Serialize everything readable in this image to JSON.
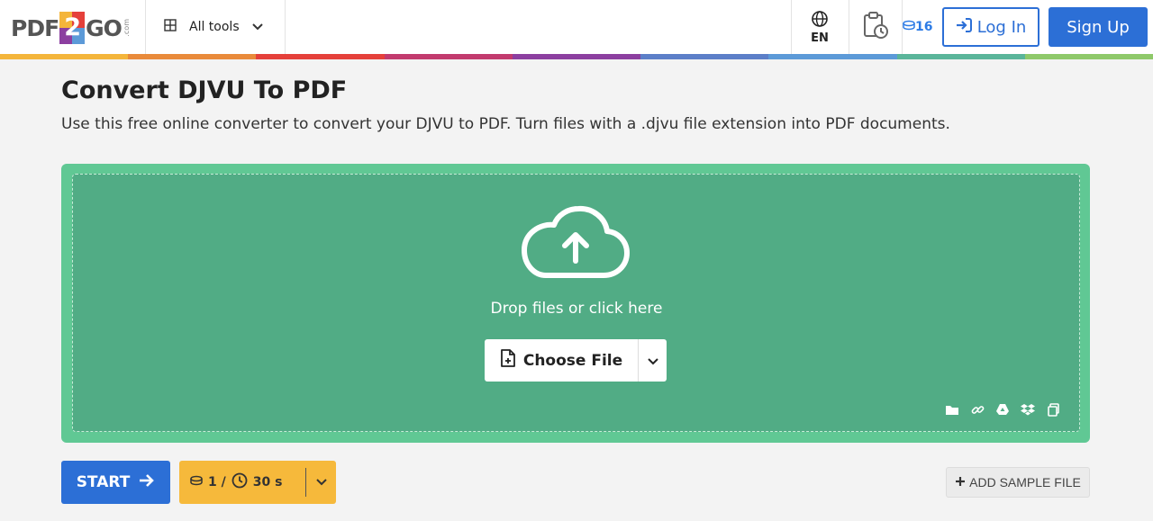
{
  "header": {
    "logo": {
      "left": "PDF",
      "middle": "2",
      "right": "GO",
      "suffix": ".com"
    },
    "all_tools_label": "All tools",
    "language_label": "EN",
    "credits": "16",
    "login_label": "Log In",
    "signup_label": "Sign Up",
    "rainbow_colors": [
      "#f4b53b",
      "#e98a3a",
      "#e5403a",
      "#c23a6e",
      "#8c3fa0",
      "#5c7fc8",
      "#5c9ad8",
      "#5ab59a",
      "#8fc96a"
    ]
  },
  "main": {
    "title": "Convert DJVU To PDF",
    "description": "Use this free online converter to convert your DJVU to PDF. Turn files with a .djvu file extension into PDF documents.",
    "drop_text": "Drop files or click here",
    "choose_file_label": "Choose File",
    "source_icons": [
      "folder-icon",
      "link-icon",
      "google-drive-icon",
      "dropbox-icon",
      "clipboard-icon"
    ]
  },
  "actions": {
    "start_label": "START",
    "cost_credits": "1 /",
    "cost_time": "30 s",
    "add_sample_label": "ADD SAMPLE FILE"
  },
  "colors": {
    "accent_blue": "#2c6fd6",
    "drop_outer": "#60c894",
    "drop_inner": "#51ac85",
    "cost_orange": "#f6b93b"
  }
}
